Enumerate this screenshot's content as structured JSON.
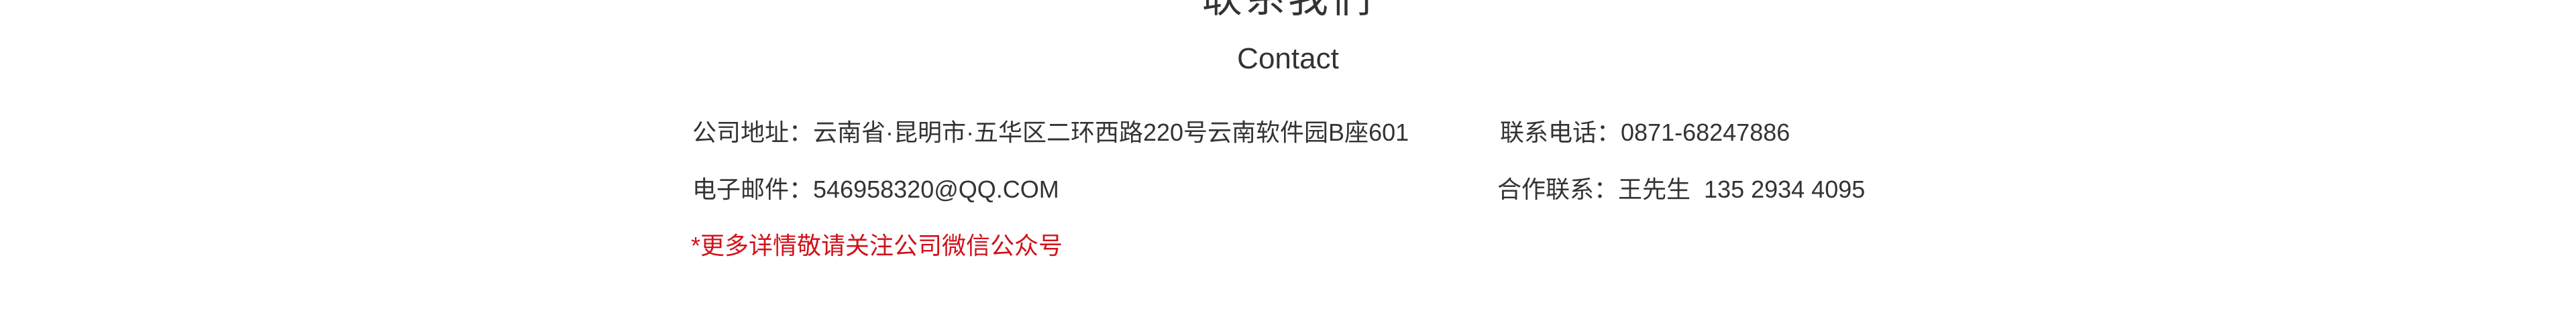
{
  "section": {
    "title_cn": "联系我们",
    "title_en": "Contact"
  },
  "contact": {
    "address_label": "公司地址：",
    "address_value": "云南省·昆明市·五华区二环西路220号云南软件园B座601",
    "phone_label": "联系电话：",
    "phone_value": "0871-68247886",
    "email_label": "电子邮件：",
    "email_value": "546958320@QQ.COM",
    "coop_label": "合作联系：",
    "coop_value": "王先生  135 2934 4095"
  },
  "note": {
    "text": "*更多详情敬请关注公司微信公众号",
    "color": "#d0121b"
  },
  "colors": {
    "text": "#333333",
    "background": "#ffffff"
  }
}
